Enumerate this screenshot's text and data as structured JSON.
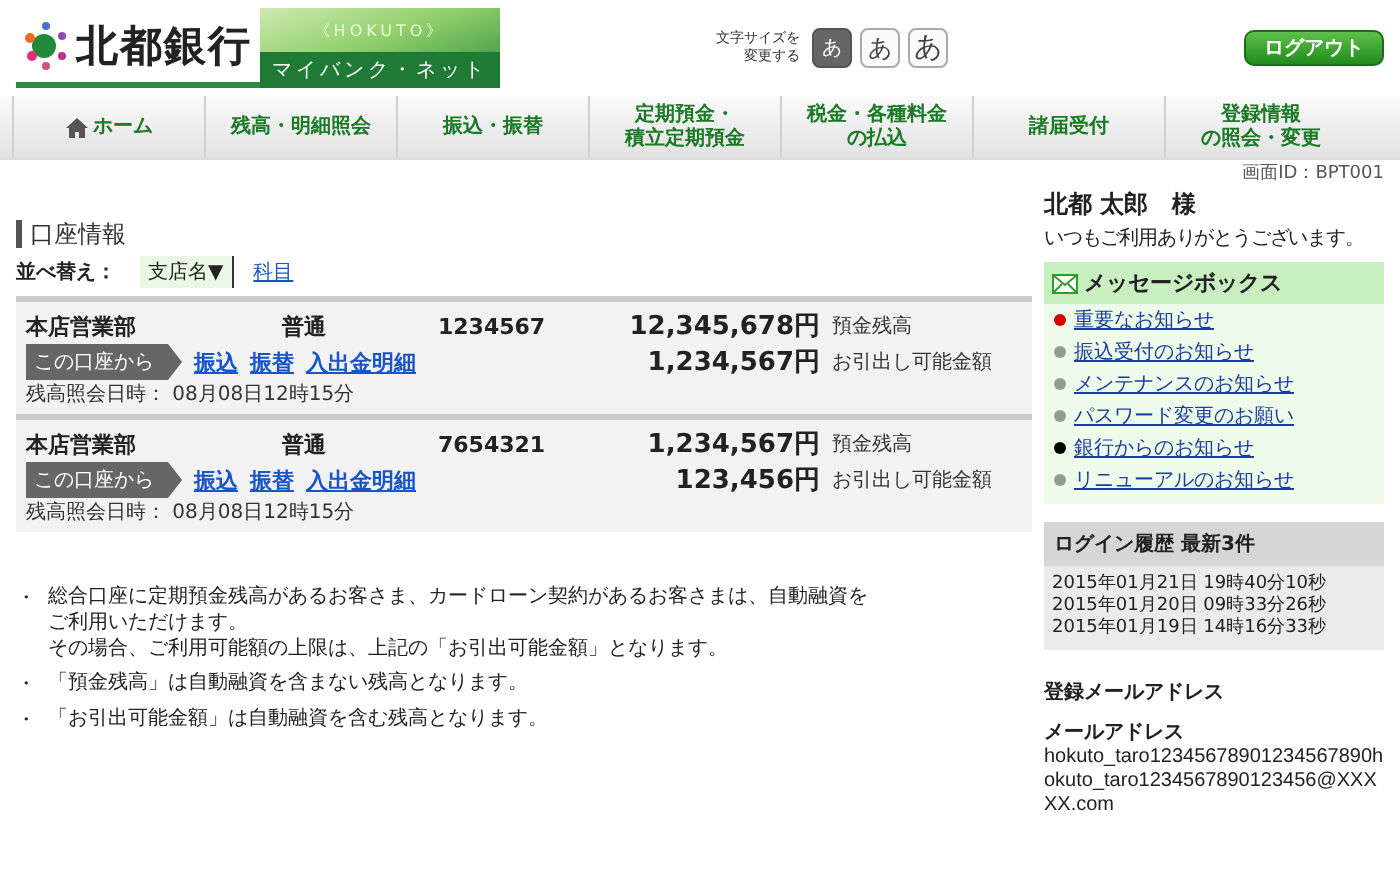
{
  "header": {
    "bank_name": "北都銀行",
    "banner_top": "《HOKUTO》",
    "banner_sub": "マイバンク・ネット",
    "font_size_label": [
      "文字サイズを",
      "変更する"
    ],
    "font_sizes": [
      {
        "label": "あ",
        "selected": true
      },
      {
        "label": "あ",
        "selected": false
      },
      {
        "label": "あ",
        "selected": false
      }
    ],
    "logout": "ログアウト"
  },
  "nav": [
    {
      "label": [
        "ホーム"
      ],
      "kind": "home"
    },
    {
      "label": [
        "残高・明細照会"
      ],
      "kind": "plain"
    },
    {
      "label": [
        "振込・振替"
      ],
      "kind": "plain"
    },
    {
      "label": [
        "定期預金・",
        "積立定期預金"
      ],
      "kind": "plain"
    },
    {
      "label": [
        "税金・各種料金",
        "の払込"
      ],
      "kind": "plain"
    },
    {
      "label": [
        "諸届受付"
      ],
      "kind": "plain"
    },
    {
      "label": [
        "登録情報",
        "の照会・変更"
      ],
      "kind": "plain"
    }
  ],
  "screen_id": "画面ID：BPT001",
  "accounts_section": {
    "title": "口座情報",
    "sort_label": "並べ替え：",
    "sort_options": [
      {
        "label": "支店名▼",
        "selected": true
      },
      {
        "label": "科目",
        "selected": false
      }
    ],
    "accounts": [
      {
        "branch": "本店営業部",
        "type": "普通",
        "number": "1234567",
        "balance": "12,345,678円",
        "balance_label": "預金残高",
        "available": "1,234,567円",
        "available_label": "お引出し可能金額",
        "from_label": "この口座から",
        "actions": [
          "振込",
          "振替",
          "入出金明細"
        ],
        "timestamp": "残高照会日時： 08月08日12時15分"
      },
      {
        "branch": "本店営業部",
        "type": "普通",
        "number": "7654321",
        "balance": "1,234,567円",
        "balance_label": "預金残高",
        "available": "123,456円",
        "available_label": "お引出し可能金額",
        "from_label": "この口座から",
        "actions": [
          "振込",
          "振替",
          "入出金明細"
        ],
        "timestamp": "残高照会日時： 08月08日12時15分"
      }
    ]
  },
  "notes": [
    {
      "bullet": "・",
      "lines": [
        "総合口座に定期預金残高があるお客さま、カードローン契約があるお客さまは、自動融資を",
        "ご利用いただけます。",
        "その場合、ご利用可能額の上限は、上記の「お引出可能金額」となります。"
      ]
    },
    {
      "bullet": "・",
      "lines": [
        "「預金残高」は自動融資を含まない残高となります。"
      ]
    },
    {
      "bullet": "・",
      "lines": [
        "「お引出可能金額」は自動融資を含む残高となります。"
      ]
    }
  ],
  "sidebar": {
    "user_name": "北都 太郎　様",
    "greeting": "いつもご利用ありがとうございます。",
    "message_box": {
      "title": "メッセージボックス",
      "items": [
        {
          "label": "重要なお知らせ",
          "color": "#dd0000"
        },
        {
          "label": "振込受付のお知らせ",
          "color": "#999999"
        },
        {
          "label": "メンテナンスのお知らせ",
          "color": "#999999"
        },
        {
          "label": "パスワード変更のお願い",
          "color": "#999999"
        },
        {
          "label": "銀行からのお知らせ",
          "color": "#000000"
        },
        {
          "label": "リニューアルのお知らせ",
          "color": "#999999"
        }
      ]
    },
    "login_history": {
      "title": "ログイン履歴 最新3件",
      "entries": [
        "2015年01月21日 19時40分10秒",
        "2015年01月20日 09時33分26秒",
        "2015年01月19日 14時16分33秒"
      ]
    },
    "email": {
      "title": "登録メールアドレス",
      "label": "メールアドレス",
      "value": "hokuto_taro12345678901234567890hokuto_taro1234567890123456@XXXXX.com"
    }
  }
}
